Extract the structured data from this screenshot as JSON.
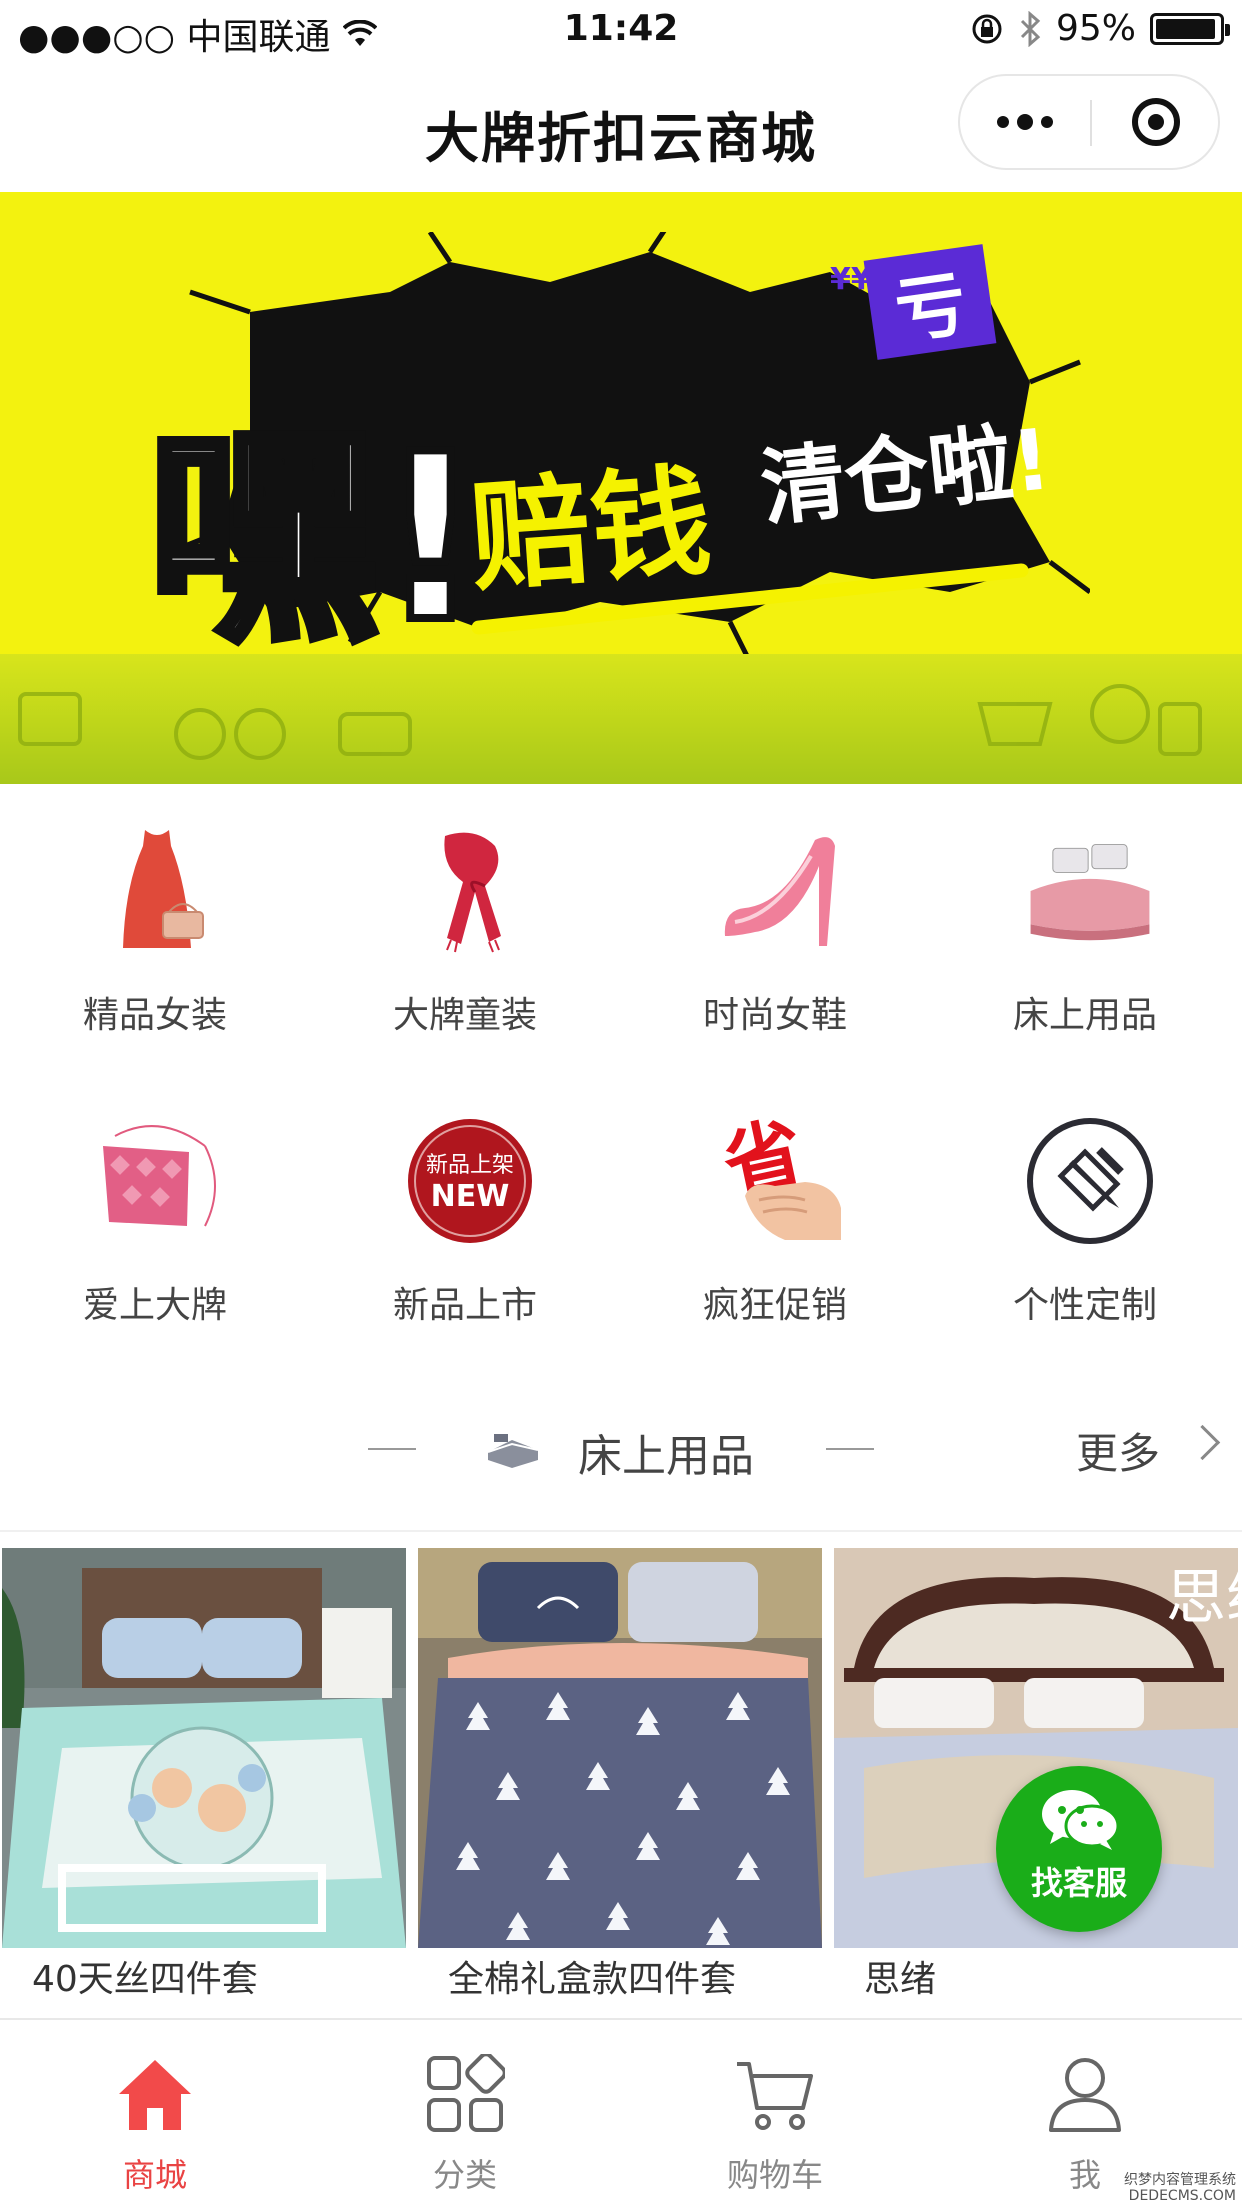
{
  "status_bar": {
    "carrier": "●●●○○ 中国联通",
    "time": "11:42",
    "battery": "95%",
    "battery_level": 0.95
  },
  "nav": {
    "title": "大牌折扣云商城"
  },
  "banner": {
    "headline_big": "嘿!",
    "headline_main": "赔钱",
    "headline_sub": "清仓啦!",
    "badge": "亏",
    "badge_currency": "¥¥",
    "slide_count": 8,
    "active_slide": 0,
    "colors": {
      "background": "#f3f20f",
      "badge": "#5b2bd6"
    }
  },
  "categories": [
    {
      "label": "精品女装",
      "icon": "dress-icon"
    },
    {
      "label": "大牌童装",
      "icon": "scarf-icon"
    },
    {
      "label": "时尚女鞋",
      "icon": "high-heel-icon"
    },
    {
      "label": "床上用品",
      "icon": "bedding-icon"
    },
    {
      "label": "爱上大牌",
      "icon": "handbag-icon"
    },
    {
      "label": "新品上市",
      "icon": "new-arrival-icon",
      "badge_top": "新品上架",
      "badge_bottom": "NEW"
    },
    {
      "label": "疯狂促销",
      "icon": "promo-hand-icon",
      "badge_text": "省"
    },
    {
      "label": "个性定制",
      "icon": "pencil-edit-icon"
    }
  ],
  "section": {
    "title": "床上用品",
    "more_label": "更多"
  },
  "products": [
    {
      "name": "40天丝四件套"
    },
    {
      "name": "全棉礼盒款四件套"
    },
    {
      "name": "思绪",
      "image_text": "思绪"
    }
  ],
  "service_button": {
    "label": "找客服",
    "color": "#1aad19"
  },
  "tabs": [
    {
      "label": "商城",
      "icon": "home-icon",
      "active": true
    },
    {
      "label": "分类",
      "icon": "category-grid-icon",
      "active": false
    },
    {
      "label": "购物车",
      "icon": "cart-icon",
      "active": false
    },
    {
      "label": "我",
      "icon": "user-icon",
      "active": false
    }
  ],
  "accent_color": "#e94343",
  "watermark": {
    "line1": "织梦内容管理系统",
    "line2": "DEDECMS.COM"
  }
}
